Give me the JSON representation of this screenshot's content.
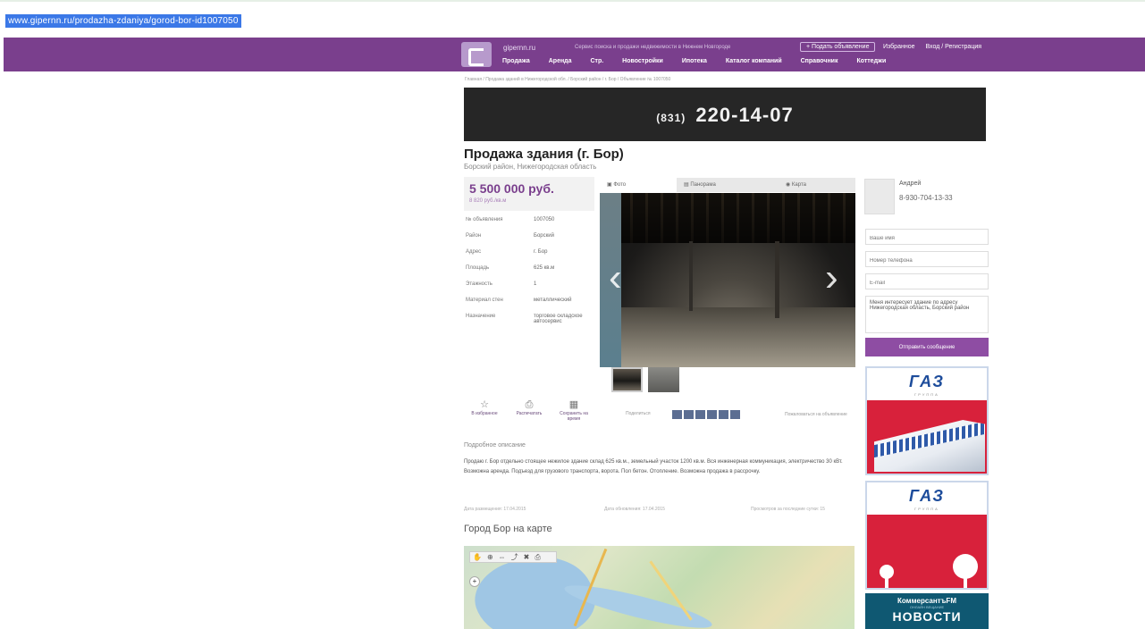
{
  "browser": {
    "url": "www.gipernn.ru/prodazha-zdaniya/gorod-bor-id1007050"
  },
  "header": {
    "brand": "gipernn.ru",
    "tagline": "Сервис поиска и продажи недвижимости в Нижнем Новгороде",
    "add_listing": "+ Подать объявление",
    "favorites": "Избранное",
    "login": "Вход / Регистрация",
    "nav": [
      "Продажа",
      "Аренда",
      "Стр.",
      "Новостройки",
      "Ипотека",
      "Каталог компаний",
      "Справочник",
      "Коттеджи"
    ]
  },
  "breadcrumb": "Главная / Продажа зданий в Нижегородской обл. / Борский район / г. Бор / Объявление № 1007050",
  "banner": {
    "phone_code": "(831)",
    "phone": "220-14-07"
  },
  "listing": {
    "title": "Продажа здания (г. Бор)",
    "location": "Борский район, Нижегородская область",
    "price": "5 500 000 руб.",
    "price_per_sqm": "8 820 руб./кв.м",
    "props": [
      {
        "k": "№ объявления",
        "v": "1007050"
      },
      {
        "k": "Район",
        "v": "Борский"
      },
      {
        "k": "Адрес",
        "v": "г. Бор"
      },
      {
        "k": "Площадь",
        "v": "625 кв.м"
      },
      {
        "k": "Этажность",
        "v": "1"
      },
      {
        "k": "Материал стен",
        "v": "металлический"
      },
      {
        "k": "Назначение",
        "v": "торговое складское автосервис"
      }
    ]
  },
  "media_tabs": [
    "Фото",
    "Панорама",
    "Карта"
  ],
  "actions": {
    "favorite": "В избранное",
    "print": "Распечатать",
    "calendar": "Сохранить на время",
    "share": "Поделиться",
    "complain": "Пожаловаться на объявление"
  },
  "description": {
    "heading": "Подробное описание",
    "text": "Продаю г. Бор отдельно стоящее нежилое здание склад 625 кв.м., земельный участок 1200 кв.м. Вся инженерная коммуникация, электричество 30 кВт. Возможна аренда. Подъезд для грузового транспорта, ворота. Пол бетон. Отопление. Возможна продажа в рассрочку."
  },
  "meta": {
    "created": "Дата размещения: 17.04.2015",
    "updated": "Дата обновления: 17.04.2015",
    "views": "Просмотров за последние сутки: 15"
  },
  "map": {
    "title": "Город Бор на карте"
  },
  "agent": {
    "name": "Андрей",
    "phone": "8-930-704-13-33"
  },
  "contact_form": {
    "name_placeholder": "Ваше имя",
    "phone_placeholder": "Номер телефона",
    "email_placeholder": "E-mail",
    "message": "Меня интересует здание по адресу Нижегородская область, Борский район",
    "send": "Отправить сообщение"
  },
  "ads": {
    "gaz1": "ГАЗ",
    "gaz2": "ГАЗ",
    "gaz_sub": "ГРУППА",
    "kom_line1": "КоммерсантъFM",
    "kom_line2": "ОНЛАЙН ВЕЩАНИЕ",
    "kom_line3": "НОВОСТИ"
  },
  "colors": {
    "brand_purple": "#7a3f8d",
    "send_button": "#8e4da3",
    "gaz_red": "#d8213b",
    "gaz_blue": "#1d4c9b",
    "kom_blue": "#0f5872"
  }
}
